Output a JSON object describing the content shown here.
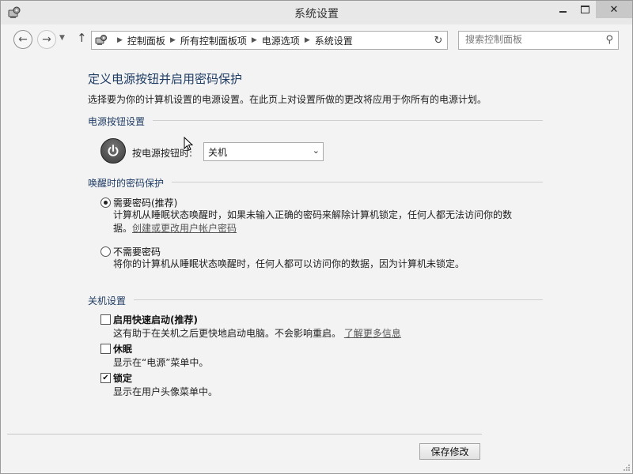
{
  "window": {
    "title": "系统设置"
  },
  "nav": {
    "breadcrumbs": [
      "控制面板",
      "所有控制面板项",
      "电源选项",
      "系统设置"
    ],
    "search_placeholder": "搜索控制面板"
  },
  "page": {
    "title": "定义电源按钮并启用密码保护",
    "description": "选择要为你的计算机设置的电源设置。在此页上对设置所做的更改将应用于你所有的电源计划。"
  },
  "power_button": {
    "section": "电源按钮设置",
    "label": "按电源按钮时:",
    "value": "关机"
  },
  "wake_password": {
    "section": "唤醒时的密码保护",
    "options": [
      {
        "label": "需要密码(推荐)",
        "selected": true,
        "desc_line1": "计算机从睡眠状态唤醒时，如果未输入正确的密码来解除计算机锁定，任何人都无法访问你的数",
        "desc_line2": "据。",
        "link": "创建或更改用户帐户密码"
      },
      {
        "label": "不需要密码",
        "selected": false,
        "desc_line1": "将你的计算机从睡眠状态唤醒时，任何人都可以访问你的数据，因为计算机未锁定。"
      }
    ]
  },
  "shutdown": {
    "section": "关机设置",
    "items": [
      {
        "label": "启用快速启动(推荐)",
        "checked": false,
        "desc": "这有助于在关机之后更快地启动电脑。不会影响重启。",
        "link": "了解更多信息"
      },
      {
        "label": "休眠",
        "checked": false,
        "desc": "显示在“电源”菜单中。"
      },
      {
        "label": "锁定",
        "checked": true,
        "desc": "显示在用户头像菜单中。"
      }
    ]
  },
  "footer": {
    "save_label": "保存修改"
  }
}
